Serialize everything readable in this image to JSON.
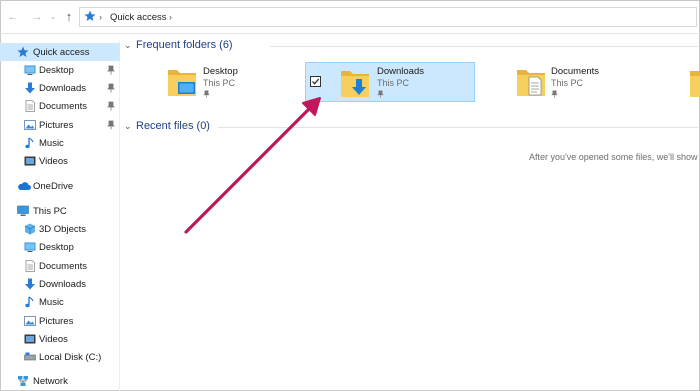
{
  "address_bar": {
    "location": "Quick access"
  },
  "sidebar": {
    "quick_access": "Quick access",
    "qa_items": [
      "Desktop",
      "Downloads",
      "Documents",
      "Pictures",
      "Music",
      "Videos"
    ],
    "onedrive": "OneDrive",
    "this_pc": "This PC",
    "pc_items": [
      "3D Objects",
      "Desktop",
      "Documents",
      "Downloads",
      "Music",
      "Pictures",
      "Videos",
      "Local Disk (C:)"
    ],
    "network": "Network"
  },
  "content": {
    "frequent_title": "Frequent folders (6)",
    "recent_title": "Recent files (0)",
    "folders": [
      {
        "name": "Desktop",
        "location": "This PC"
      },
      {
        "name": "Downloads",
        "location": "This PC"
      },
      {
        "name": "Documents",
        "location": "This PC"
      }
    ],
    "empty_message": "After you've opened some files, we'll show"
  },
  "colors": {
    "selection": "#cce8ff",
    "folder": "#f0c24f",
    "annotation_arrow": "#c2185b"
  }
}
